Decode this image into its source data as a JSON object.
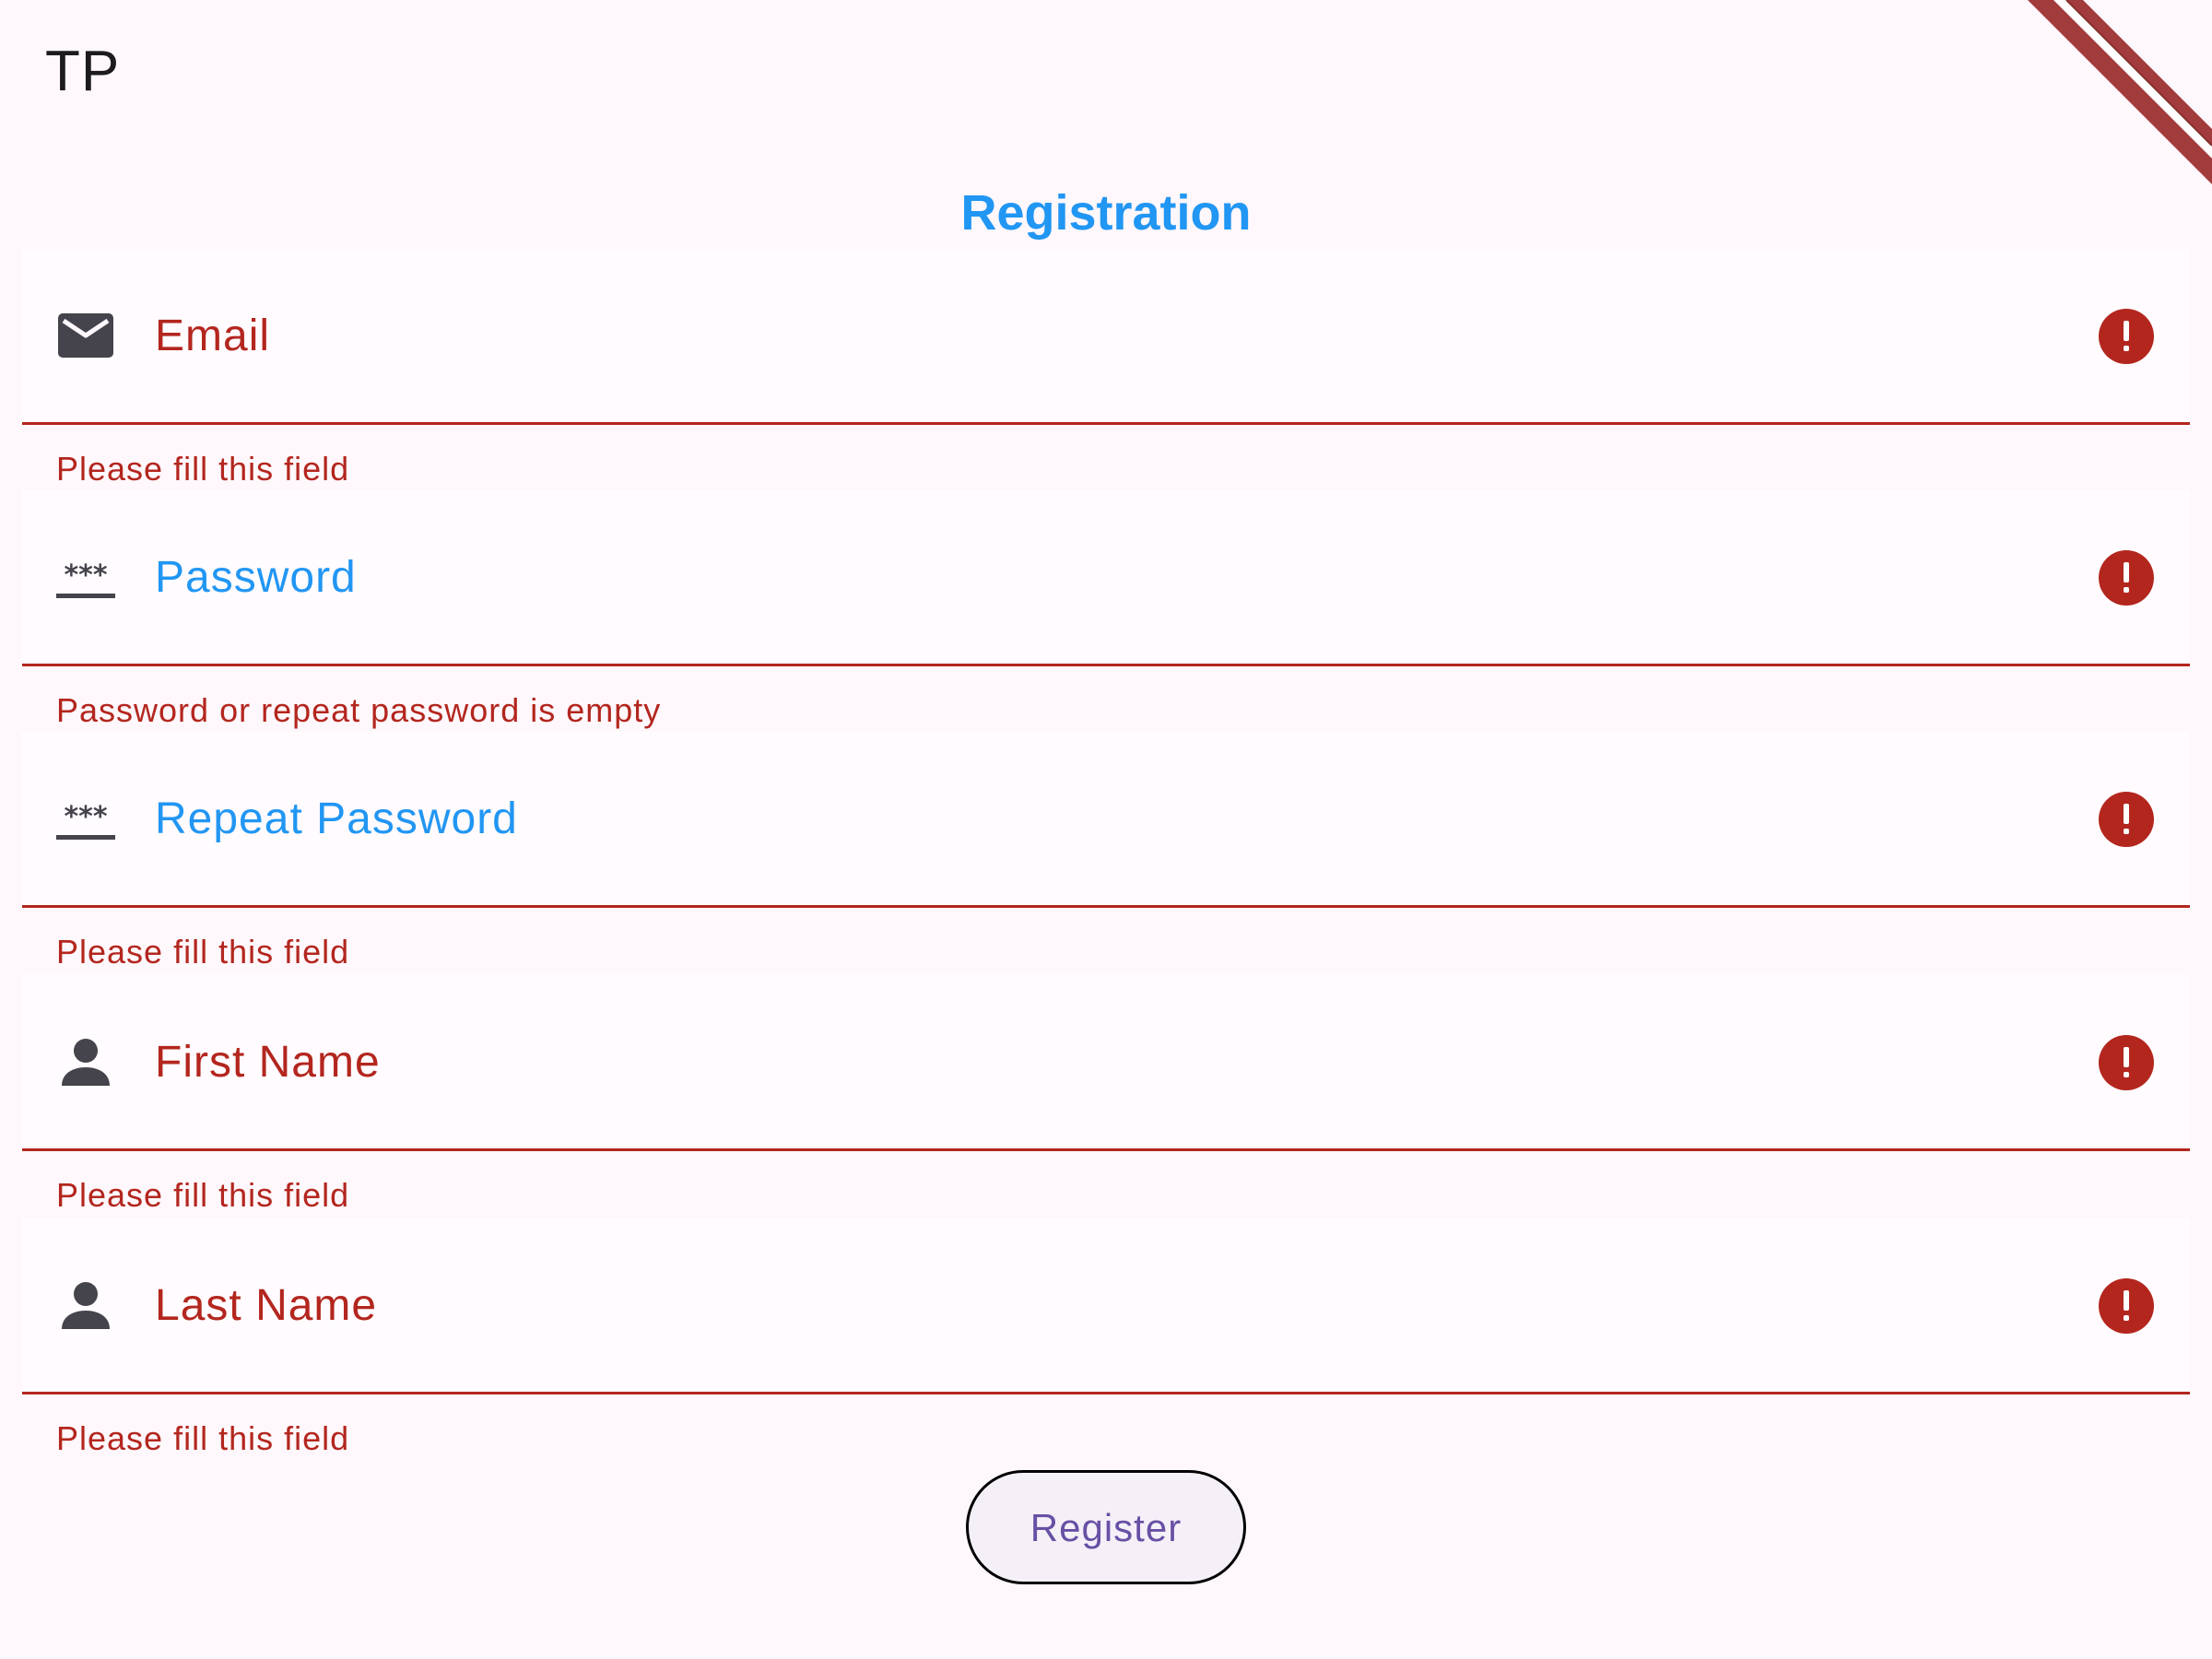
{
  "app": {
    "title": "TP"
  },
  "page": {
    "heading": "Registration"
  },
  "fields": [
    {
      "label": "Email",
      "icon": "email-icon",
      "helper": "Please fill this field",
      "label_state": "error"
    },
    {
      "label": "Password",
      "icon": "password-icon",
      "helper": "Password or repeat password is empty",
      "label_state": "focused"
    },
    {
      "label": "Repeat Password",
      "icon": "password-icon",
      "helper": "Please fill this field",
      "label_state": "focused"
    },
    {
      "label": "First Name",
      "icon": "person-icon",
      "helper": "Please fill this field",
      "label_state": "error"
    },
    {
      "label": "Last Name",
      "icon": "person-icon",
      "helper": "Please fill this field",
      "label_state": "error"
    }
  ],
  "actions": {
    "register_label": "Register"
  },
  "colors": {
    "background": "#fef7fb",
    "accent": "#2196f3",
    "error": "#b3261e",
    "button_text": "#6750a4",
    "icon": "#45434c"
  }
}
